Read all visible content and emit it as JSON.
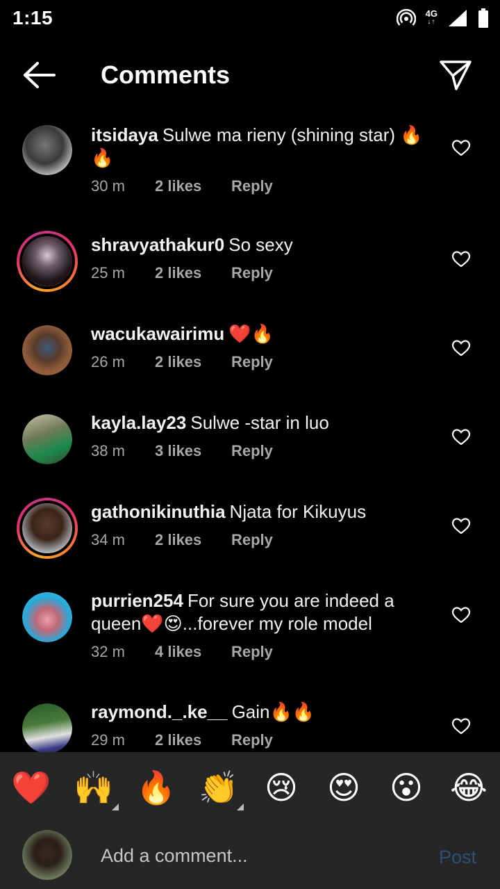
{
  "status_bar": {
    "time": "1:15",
    "network": "4G",
    "network_arrows": "↓↑"
  },
  "header": {
    "title": "Comments"
  },
  "comments": [
    {
      "username": "itsidaya",
      "text": "Sulwe ma rieny (shining star) 🔥🔥",
      "time": "30 m",
      "likes": "2 likes",
      "reply": "Reply"
    },
    {
      "username": "shravyathakur0",
      "text": "So sexy",
      "time": "25 m",
      "likes": "2 likes",
      "reply": "Reply"
    },
    {
      "username": "wacukawairimu",
      "text": "❤️🔥",
      "time": "26 m",
      "likes": "2 likes",
      "reply": "Reply"
    },
    {
      "username": "kayla.lay23",
      "text": "Sulwe -star in luo",
      "time": "38 m",
      "likes": "3 likes",
      "reply": "Reply"
    },
    {
      "username": "gathonikinuthia",
      "text": "Njata for Kikuyus",
      "time": "34 m",
      "likes": "2 likes",
      "reply": "Reply"
    },
    {
      "username": "purrien254",
      "text": "For sure you are indeed a queen❤️😍...forever my role model",
      "time": "32 m",
      "likes": "4 likes",
      "reply": "Reply"
    },
    {
      "username": "raymond._.ke__",
      "text": "Gain🔥🔥",
      "time": "29 m",
      "likes": "2 likes",
      "reply": "Reply"
    }
  ],
  "reactions": [
    "❤️",
    "🙌",
    "🔥",
    "👏",
    "😢",
    "😍",
    "😮",
    "😂"
  ],
  "composer": {
    "placeholder": "Add a comment...",
    "post_label": "Post"
  },
  "colors": {
    "background": "#000000",
    "panel": "#262626",
    "post_disabled": "#2d4f7a",
    "meta_text": "#a8a8a8"
  }
}
